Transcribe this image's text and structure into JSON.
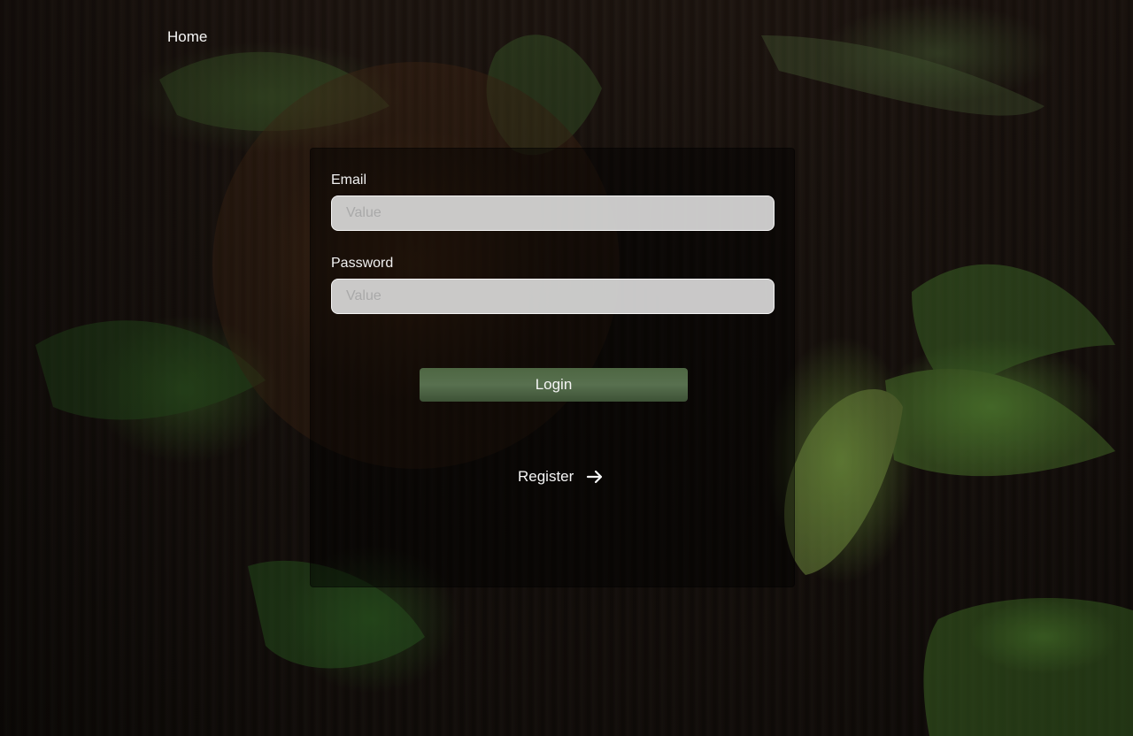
{
  "nav": {
    "home_label": "Home"
  },
  "login_form": {
    "email": {
      "label": "Email",
      "placeholder": "Value",
      "value": ""
    },
    "password": {
      "label": "Password",
      "placeholder": "Value",
      "value": ""
    },
    "login_button_label": "Login",
    "register_label": "Register",
    "register_icon": "arrow-right-icon"
  },
  "colors": {
    "card_overlay": "#000000",
    "input_background": "#dedede",
    "button_accent": "#4e6743",
    "text": "#f5f5f5"
  }
}
